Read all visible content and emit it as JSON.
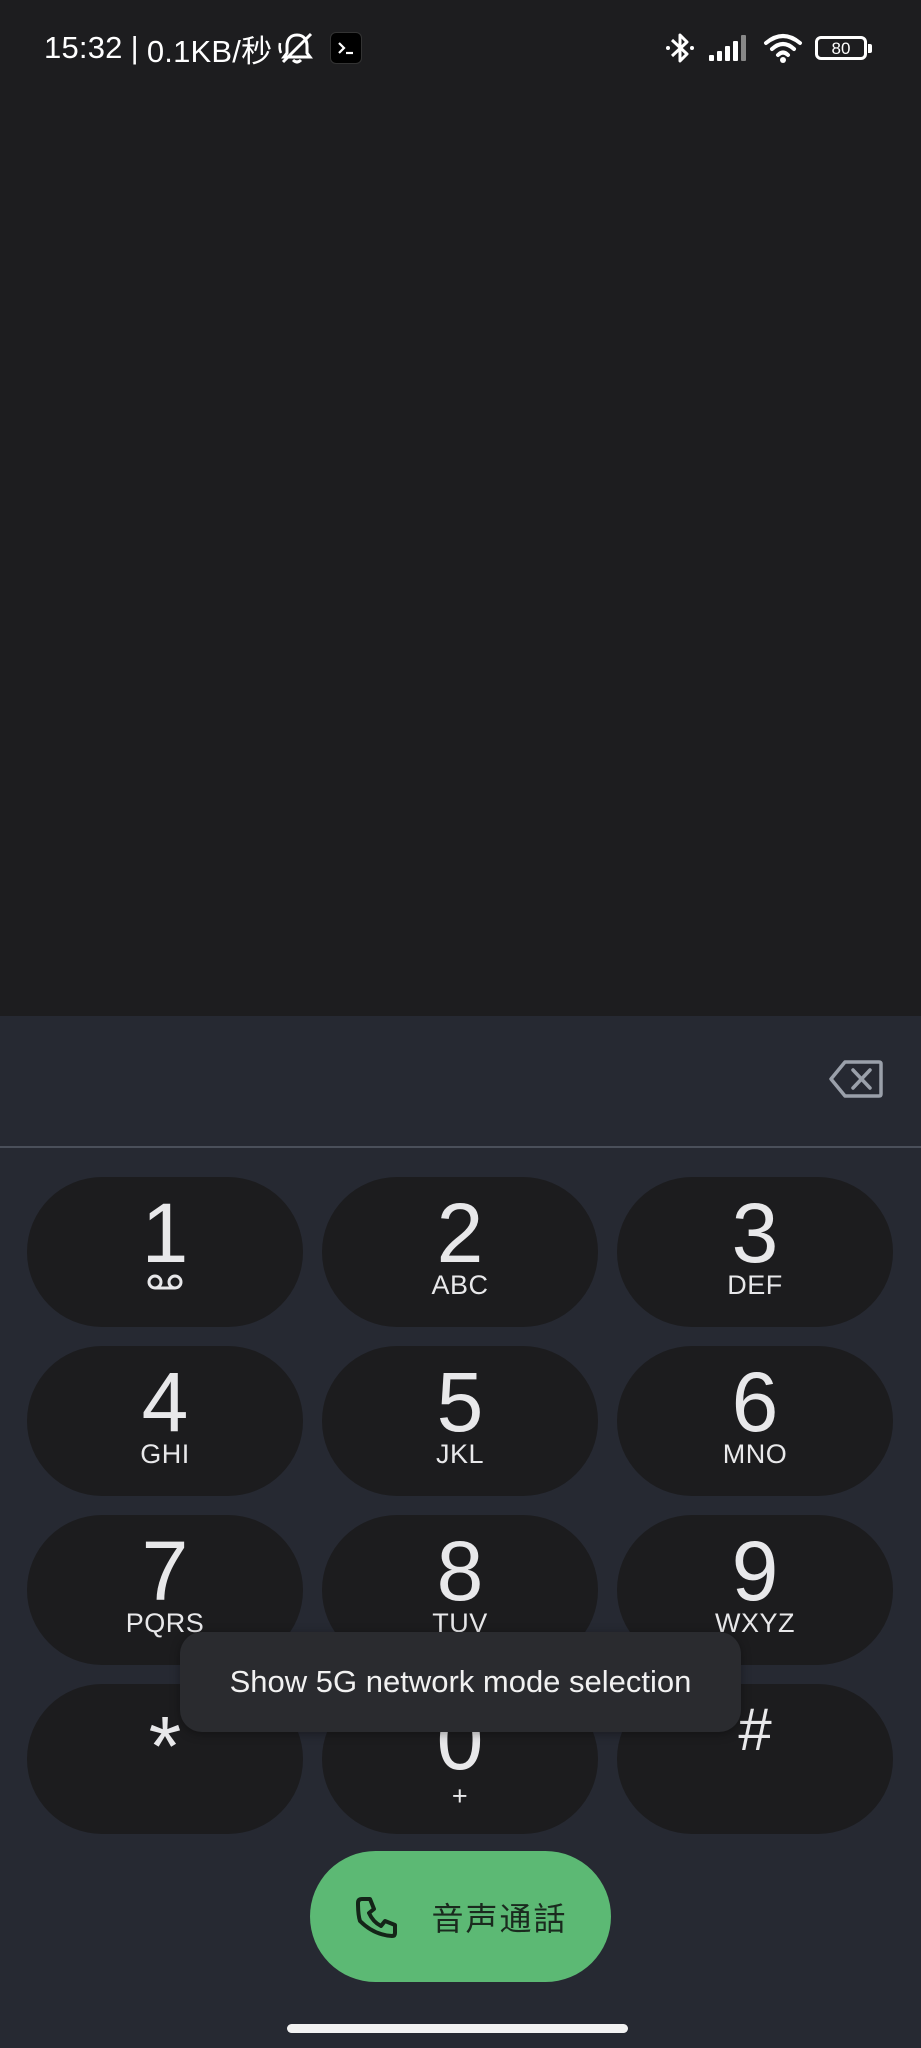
{
  "status_bar": {
    "time": "15:32",
    "separator": "|",
    "network_speed": "0.1KB/秒",
    "battery_level": "80",
    "icons": [
      "mute-bell-icon",
      "terminal-icon",
      "bluetooth-icon",
      "signal-icon",
      "wifi-icon",
      "battery-icon"
    ]
  },
  "dialer": {
    "number_value": "",
    "backspace_icon": "backspace-icon",
    "keys": [
      {
        "digit": "1",
        "sub": "",
        "sub_icon": "voicemail-icon"
      },
      {
        "digit": "2",
        "sub": "ABC"
      },
      {
        "digit": "3",
        "sub": "DEF"
      },
      {
        "digit": "4",
        "sub": "GHI"
      },
      {
        "digit": "5",
        "sub": "JKL"
      },
      {
        "digit": "6",
        "sub": "MNO"
      },
      {
        "digit": "7",
        "sub": "PQRS"
      },
      {
        "digit": "8",
        "sub": "TUV"
      },
      {
        "digit": "9",
        "sub": "WXYZ"
      },
      {
        "digit": "*",
        "sub": ""
      },
      {
        "digit": "0",
        "sub": "+"
      },
      {
        "digit": "#",
        "sub": ""
      }
    ],
    "call_button": {
      "label": "音声通話",
      "icon": "phone-icon",
      "color": "#5cb974"
    }
  },
  "tooltip": {
    "text": "Show 5G network mode selection"
  },
  "colors": {
    "background": "#1d1d1f",
    "dialer_panel": "#262932",
    "key_background": "#1c1c1e",
    "accent_green": "#5cb974"
  }
}
